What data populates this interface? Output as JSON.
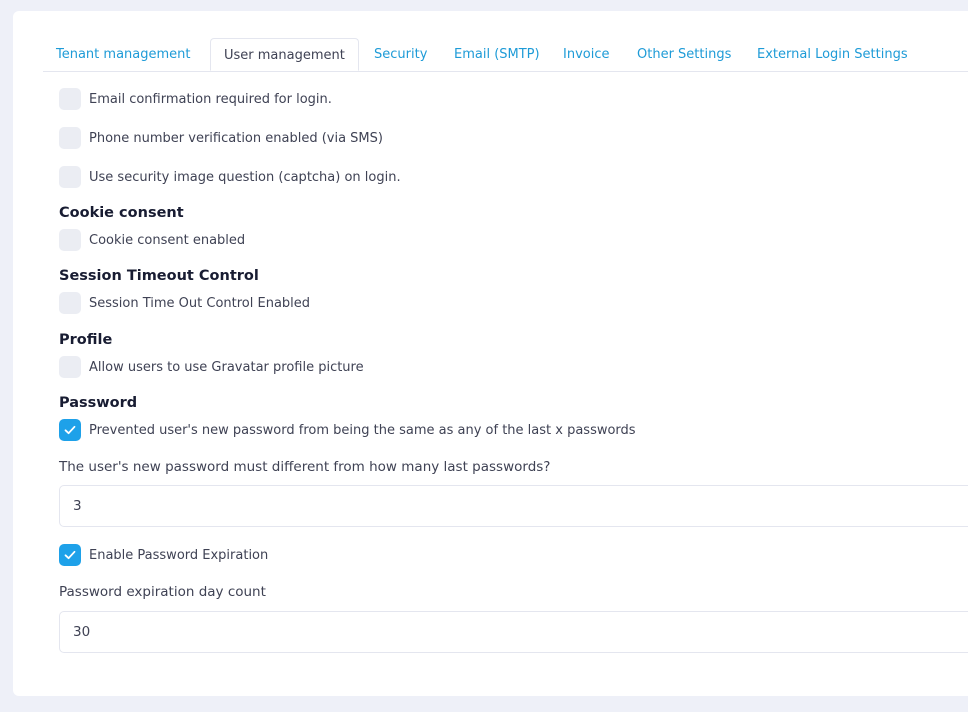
{
  "tabs": [
    {
      "label": "Tenant management"
    },
    {
      "label": "User management"
    },
    {
      "label": "Security"
    },
    {
      "label": "Email (SMTP)"
    },
    {
      "label": "Invoice"
    },
    {
      "label": "Other Settings"
    },
    {
      "label": "External Login Settings"
    }
  ],
  "active_tab": "User management",
  "colors": {
    "accent": "#1ea1e9",
    "tab_link": "#1e9bd7",
    "checkbox_off": "#ebedf3",
    "page_bg": "#eef0f8"
  },
  "login": {
    "email_confirmation": {
      "label": "Email confirmation required for login.",
      "checked": false
    },
    "phone_verification": {
      "label": "Phone number verification enabled (via SMS)",
      "checked": false
    },
    "captcha": {
      "label": "Use security image question (captcha) on login.",
      "checked": false
    }
  },
  "cookie_consent": {
    "title": "Cookie consent",
    "enabled": {
      "label": "Cookie consent enabled",
      "checked": false
    }
  },
  "session_timeout": {
    "title": "Session Timeout Control",
    "enabled": {
      "label": "Session Time Out Control Enabled",
      "checked": false
    }
  },
  "profile": {
    "title": "Profile",
    "gravatar": {
      "label": "Allow users to use Gravatar profile picture",
      "checked": false
    }
  },
  "password": {
    "title": "Password",
    "prevent_reuse": {
      "label": "Prevented user's new password from being the same as any of the last x passwords",
      "checked": true
    },
    "last_passwords_label": "The user's new password must different from how many last passwords?",
    "last_passwords_value": "3",
    "expiration": {
      "label": "Enable Password Expiration",
      "checked": true
    },
    "expiration_days_label": "Password expiration day count",
    "expiration_days_value": "30"
  }
}
